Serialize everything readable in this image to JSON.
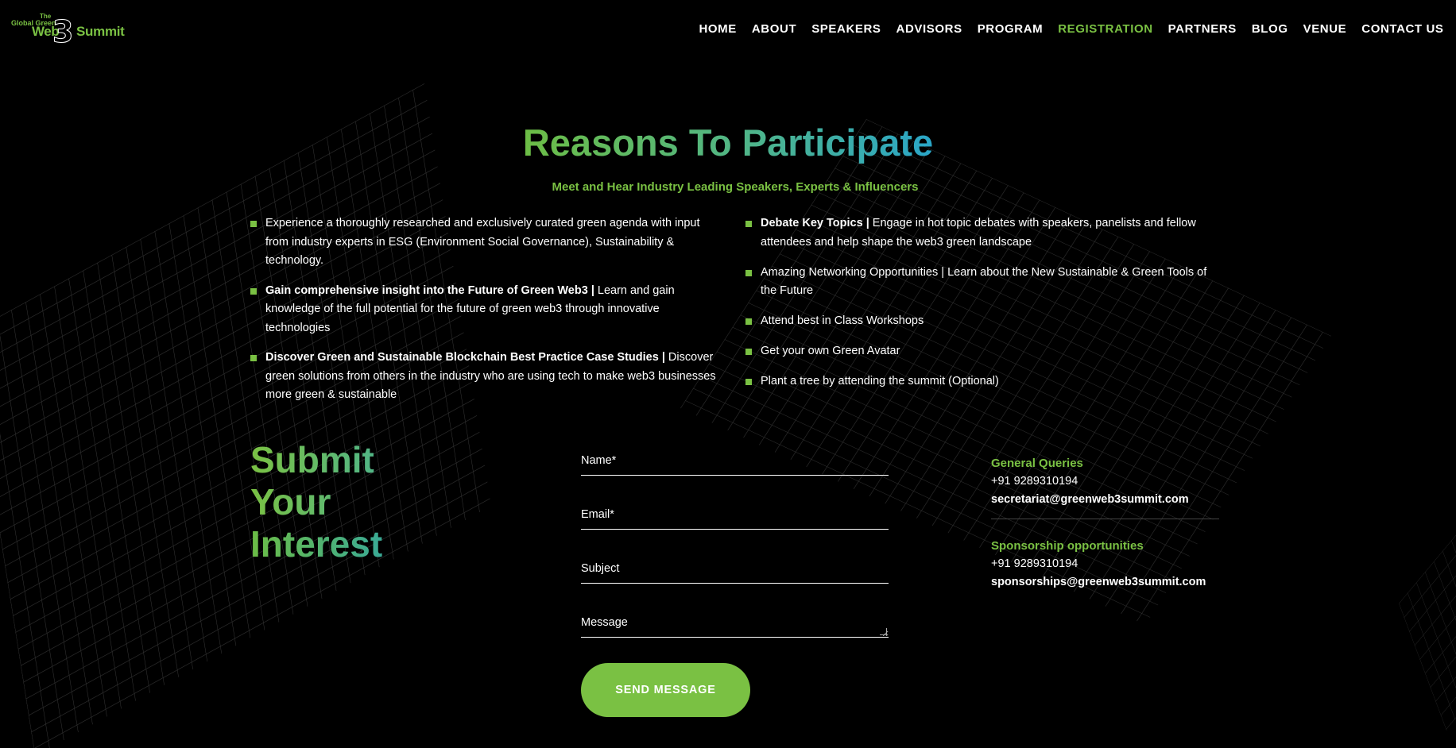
{
  "colors": {
    "accent": "#7ac143",
    "background": "#000000",
    "gradient_end": "#2aa6c8"
  },
  "logo": {
    "the": "The",
    "global_green": "Global Green",
    "web": "Web",
    "three": "3",
    "summit": "Summit"
  },
  "nav": {
    "items": [
      "HOME",
      "ABOUT",
      "SPEAKERS",
      "ADVISORS",
      "PROGRAM",
      "REGISTRATION",
      "PARTNERS",
      "BLOG",
      "VENUE",
      "CONTACT US"
    ],
    "active": "REGISTRATION"
  },
  "reasons": {
    "title": "Reasons To Participate",
    "subtitle": "Meet and Hear Industry Leading Speakers, Experts & Influencers",
    "left": [
      {
        "bold": "",
        "text": "Experience a thoroughly researched and exclusively curated green agenda with input from industry experts in ESG (Environment Social Governance), Sustainability & technology."
      },
      {
        "bold": "Gain comprehensive insight into the Future of Green Web3 |",
        "text": " Learn and gain knowledge of the full potential for the future of green web3 through innovative technologies"
      },
      {
        "bold": "Discover Green and Sustainable Blockchain Best Practice Case Studies |",
        "text": " Discover green solutions from others in the industry who are using tech to make web3 businesses more green & sustainable"
      }
    ],
    "right": [
      {
        "bold": "Debate Key Topics |",
        "text": " Engage in hot topic debates with speakers, panelists and fellow attendees and help shape the web3 green landscape"
      },
      {
        "bold": "",
        "text": "Amazing Networking Opportunities | Learn about the New Sustainable & Green Tools of the Future"
      },
      {
        "bold": "",
        "text": "Attend best in Class Workshops"
      },
      {
        "bold": "",
        "text": "Get your own Green Avatar"
      },
      {
        "bold": "",
        "text": "Plant a tree by attending the summit (Optional)"
      }
    ]
  },
  "submit": {
    "title_lines": [
      "Submit",
      "Your",
      "Interest"
    ],
    "fields": {
      "name": "Name*",
      "email": "Email*",
      "subject": "Subject",
      "message": "Message"
    },
    "button": "SEND MESSAGE"
  },
  "contact": {
    "general_heading": "General Queries",
    "general_phone": "+91 9289310194",
    "general_email": "secretariat@greenweb3summit.com",
    "sponsor_heading": "Sponsorship opportunities",
    "sponsor_phone": "+91 9289310194",
    "sponsor_email": "sponsorships@greenweb3summit.com"
  }
}
